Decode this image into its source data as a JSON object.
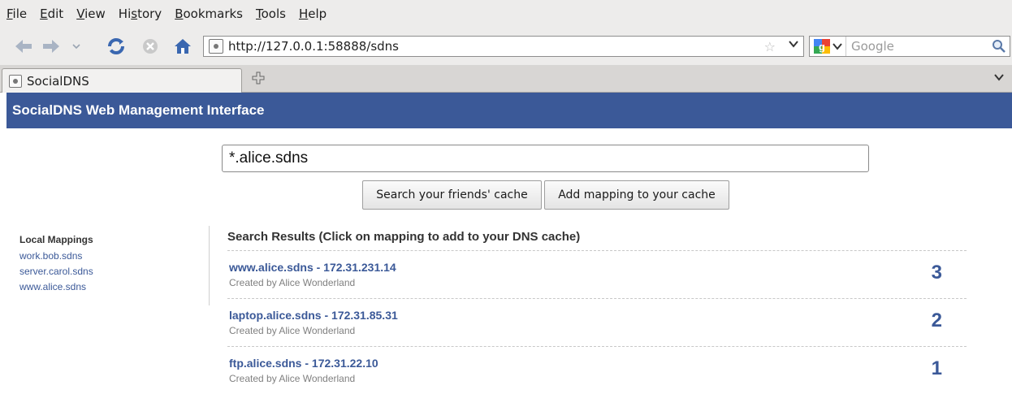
{
  "menu": [
    {
      "prefix": "",
      "accel": "F",
      "suffix": "ile"
    },
    {
      "prefix": "",
      "accel": "E",
      "suffix": "dit"
    },
    {
      "prefix": "",
      "accel": "V",
      "suffix": "iew"
    },
    {
      "prefix": "Hi",
      "accel": "s",
      "suffix": "tory"
    },
    {
      "prefix": "",
      "accel": "B",
      "suffix": "ookmarks"
    },
    {
      "prefix": "",
      "accel": "T",
      "suffix": "ools"
    },
    {
      "prefix": "",
      "accel": "H",
      "suffix": "elp"
    }
  ],
  "toolbar": {
    "url": "http://127.0.0.1:58888/sdns",
    "search_placeholder": "Google"
  },
  "tab": {
    "title": "SocialDNS"
  },
  "page": {
    "header": "SocialDNS Web Management Interface",
    "query": "*.alice.sdns",
    "search_button": "Search your friends' cache",
    "add_button": "Add mapping to your cache"
  },
  "sidebar": {
    "title": "Local Mappings",
    "items": [
      "work.bob.sdns",
      "server.carol.sdns",
      "www.alice.sdns"
    ]
  },
  "results": {
    "title": "Search Results (Click on mapping to add to your DNS cache)",
    "items": [
      {
        "mapping": "www.alice.sdns - 172.31.231.14",
        "creator": "Created by Alice Wonderland",
        "count": "3"
      },
      {
        "mapping": "laptop.alice.sdns - 172.31.85.31",
        "creator": "Created by Alice Wonderland",
        "count": "2"
      },
      {
        "mapping": "ftp.alice.sdns - 172.31.22.10",
        "creator": "Created by Alice Wonderland",
        "count": "1"
      }
    ]
  },
  "colors": {
    "brand": "#3b5998",
    "chrome": "#edeceb"
  }
}
